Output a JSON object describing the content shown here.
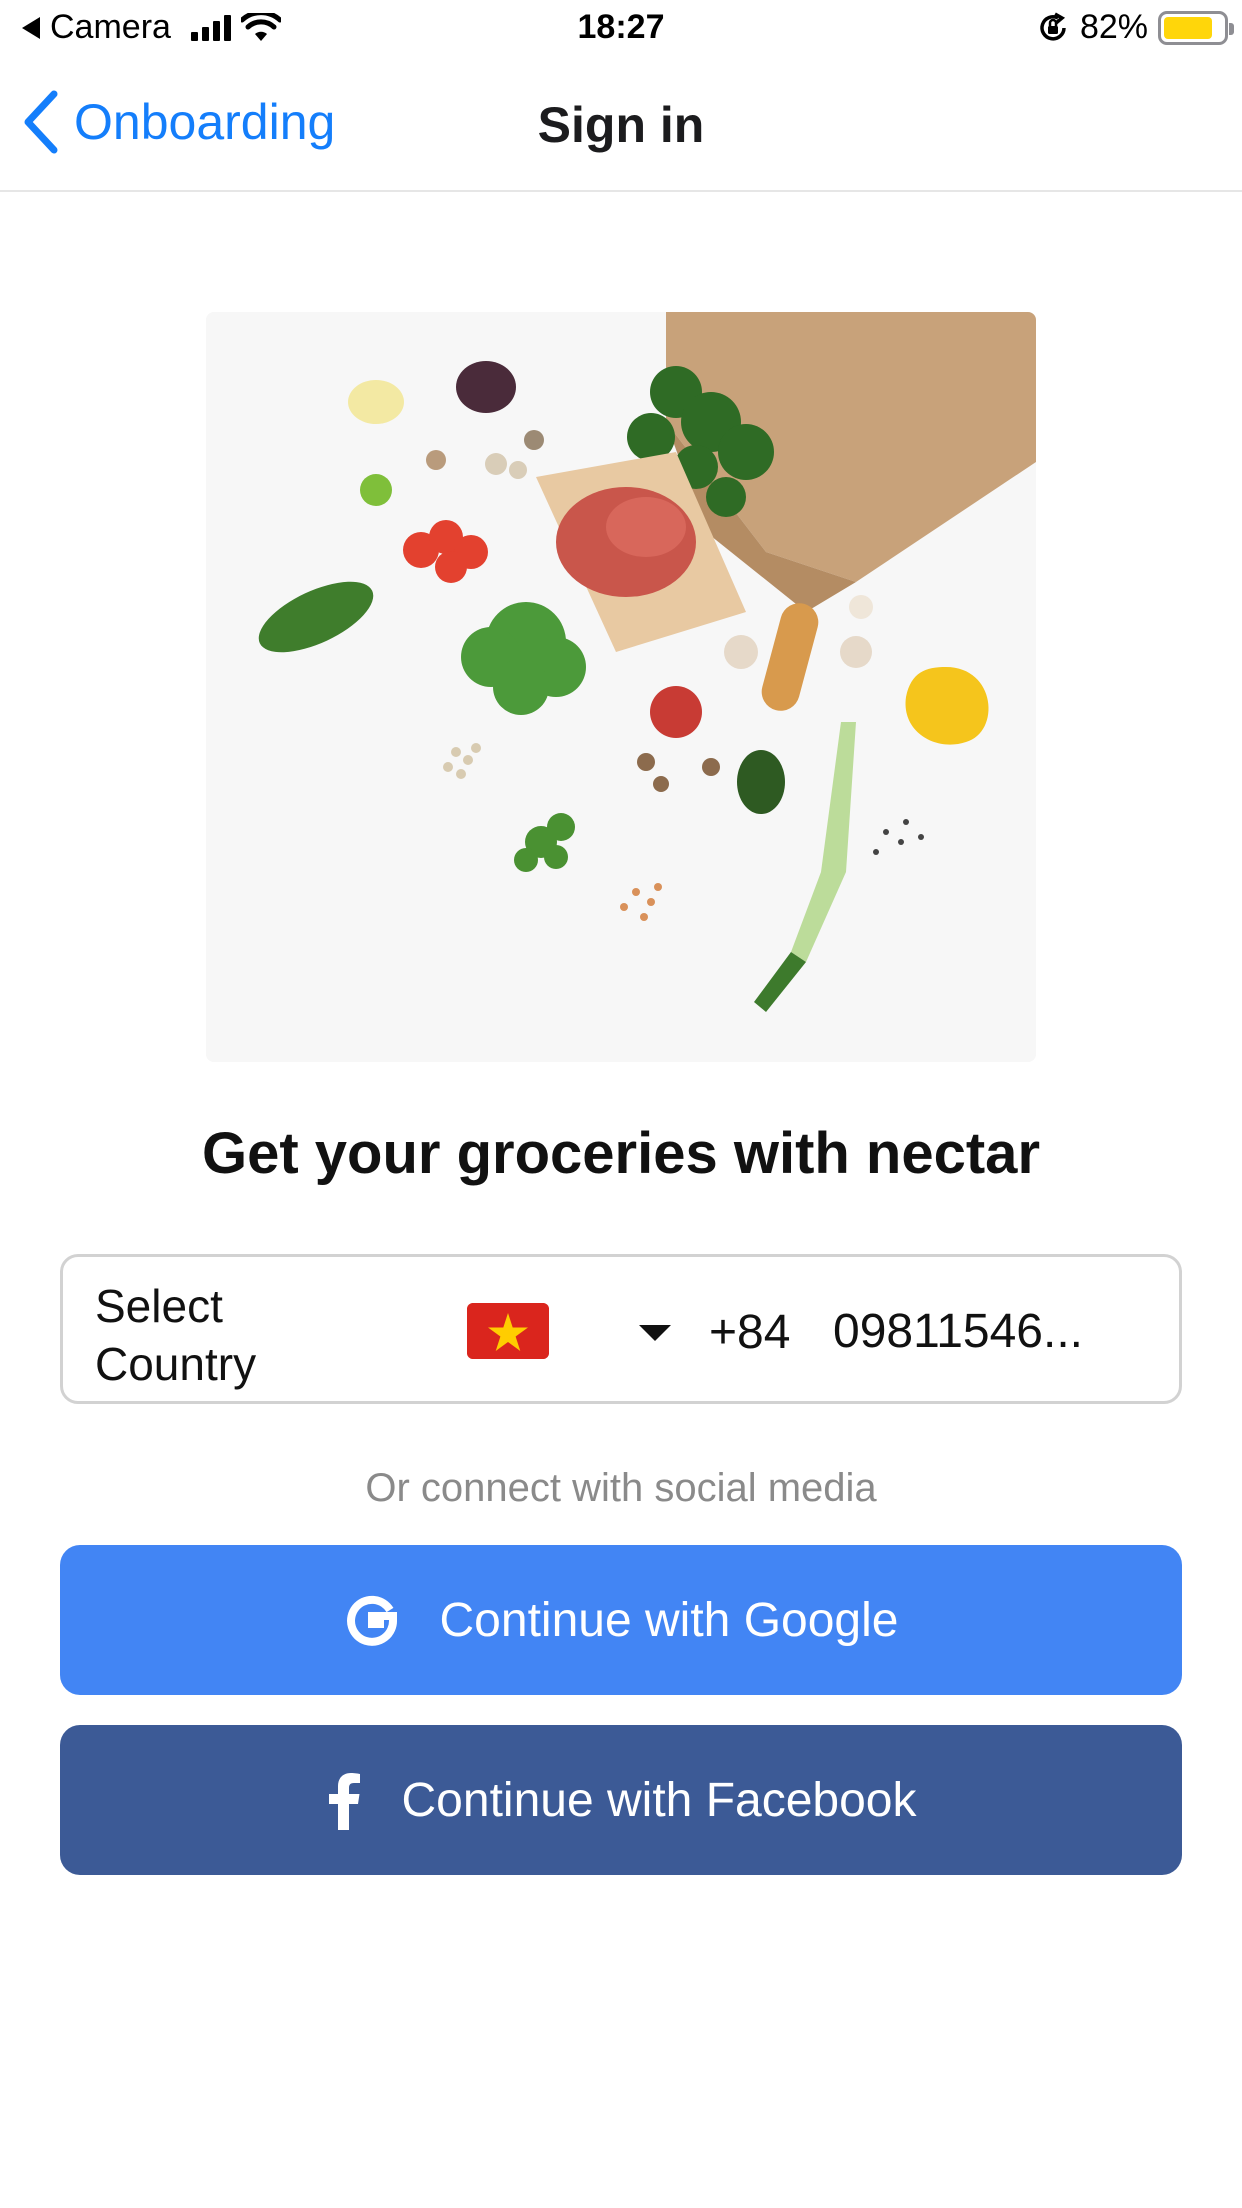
{
  "status_bar": {
    "carrier": "Camera",
    "time": "18:27",
    "battery_percent": "82%",
    "battery_level": 0.82,
    "icons": [
      "back-to-app-icon",
      "signal-icon",
      "wifi-icon",
      "orientation-lock-icon",
      "battery-icon"
    ]
  },
  "nav": {
    "back_label": "Onboarding",
    "title": "Sign in"
  },
  "hero": {
    "alt": "Groceries spilling from a paper bag"
  },
  "heading": "Get your groceries with nectar",
  "phone": {
    "country_label": "Select Country",
    "flag": "Vietnam flag",
    "dial_code": "+84",
    "number": "09811546..."
  },
  "social_caption": "Or connect with social media",
  "buttons": {
    "google_label": "Continue with Google",
    "facebook_label": "Continue with Facebook"
  },
  "colors": {
    "accent": "#147efb",
    "google": "#4285f4",
    "facebook": "#3c5a96",
    "battery": "#ffd60a",
    "flag_red": "#da251d",
    "flag_star": "#ffcd00"
  }
}
